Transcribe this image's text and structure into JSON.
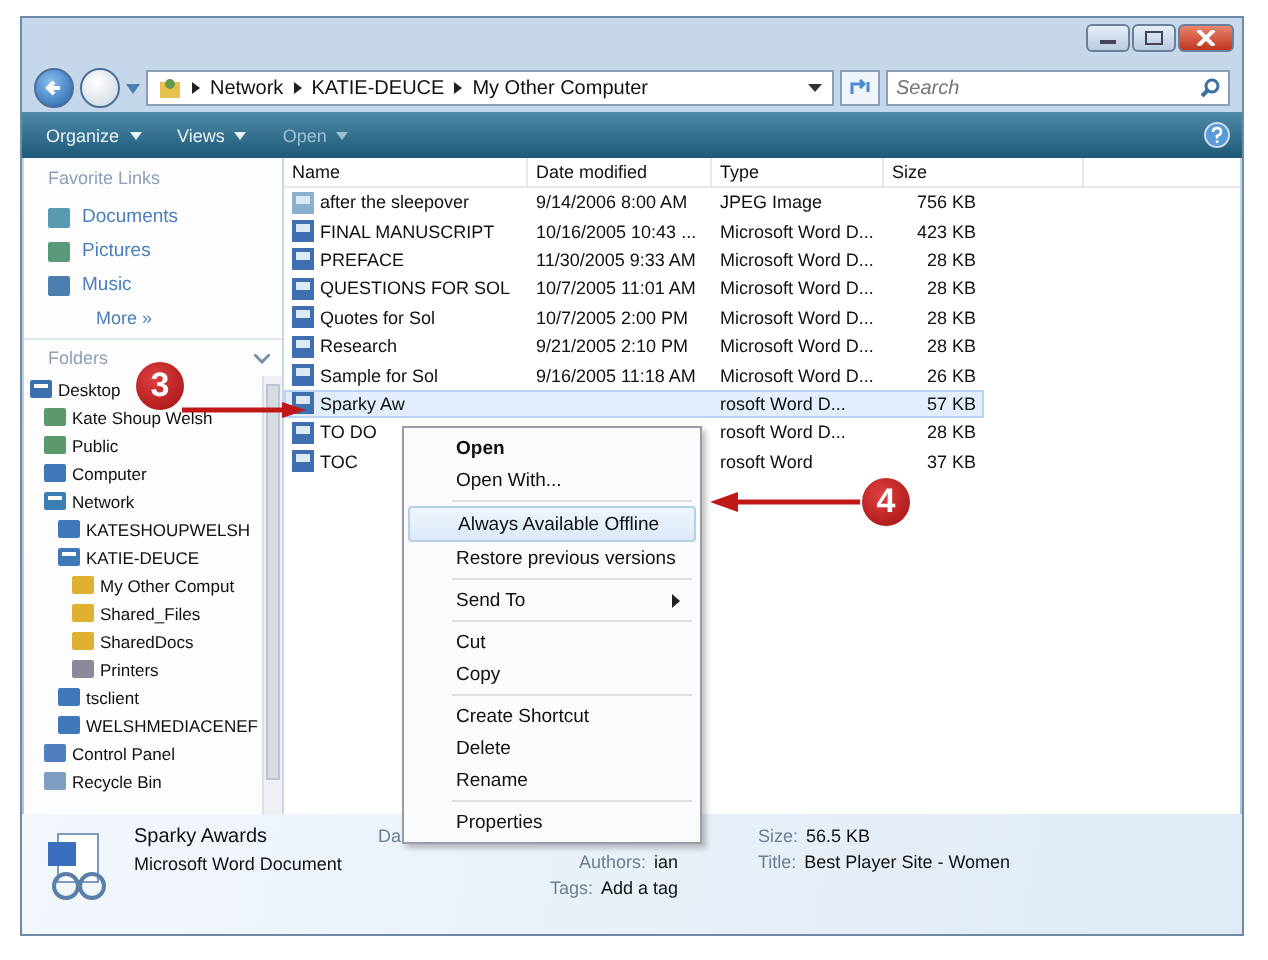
{
  "address": {
    "crumbs": [
      "Network",
      "KATIE-DEUCE",
      "My Other Computer"
    ]
  },
  "search": {
    "placeholder": "Search"
  },
  "toolbar": [
    {
      "label": "Organize",
      "disabled": false
    },
    {
      "label": "Views",
      "disabled": false
    },
    {
      "label": "Open",
      "disabled": true
    }
  ],
  "favorite_links": {
    "title": "Favorite Links",
    "items": [
      {
        "label": "Documents",
        "kind": "docs"
      },
      {
        "label": "Pictures",
        "kind": "pics"
      },
      {
        "label": "Music",
        "kind": "music"
      }
    ],
    "more": "More »"
  },
  "folders": {
    "title": "Folders",
    "tree": [
      {
        "label": "Desktop",
        "kind": "desktop",
        "expanded": true,
        "children": [
          {
            "label": "Kate Shoup Welsh",
            "kind": "user"
          },
          {
            "label": "Public",
            "kind": "user"
          },
          {
            "label": "Computer",
            "kind": "computer"
          },
          {
            "label": "Network",
            "kind": "network",
            "expanded": true,
            "children": [
              {
                "label": "KATESHOUPWELSH",
                "kind": "computer"
              },
              {
                "label": "KATIE-DEUCE",
                "kind": "computer",
                "expanded": true,
                "children": [
                  {
                    "label": "My Other Comput",
                    "kind": "share"
                  },
                  {
                    "label": "Shared_Files",
                    "kind": "share"
                  },
                  {
                    "label": "SharedDocs",
                    "kind": "share"
                  },
                  {
                    "label": "Printers",
                    "kind": "printer"
                  }
                ]
              },
              {
                "label": "tsclient",
                "kind": "computer"
              },
              {
                "label": "WELSHMEDIACENEF",
                "kind": "computer"
              }
            ]
          },
          {
            "label": "Control Panel",
            "kind": "control"
          },
          {
            "label": "Recycle Bin",
            "kind": "recycle"
          }
        ]
      }
    ]
  },
  "table": {
    "columns": [
      "Name",
      "Date modified",
      "Type",
      "Size"
    ],
    "rows": [
      {
        "name": "after the sleepover",
        "date": "9/14/2006 8:00 AM",
        "type": "JPEG Image",
        "size": "756 KB",
        "kind": "image",
        "selected": false
      },
      {
        "name": "FINAL MANUSCRIPT",
        "date": "10/16/2005 10:43 ...",
        "type": "Microsoft Word D...",
        "size": "423 KB",
        "kind": "doc",
        "selected": false
      },
      {
        "name": "PREFACE",
        "date": "11/30/2005 9:33 AM",
        "type": "Microsoft Word D...",
        "size": "28 KB",
        "kind": "doc",
        "selected": false
      },
      {
        "name": "QUESTIONS FOR SOL",
        "date": "10/7/2005 11:01 AM",
        "type": "Microsoft Word D...",
        "size": "28 KB",
        "kind": "doc",
        "selected": false
      },
      {
        "name": "Quotes for Sol",
        "date": "10/7/2005 2:00 PM",
        "type": "Microsoft Word D...",
        "size": "28 KB",
        "kind": "doc",
        "selected": false
      },
      {
        "name": "Research",
        "date": "9/21/2005 2:10 PM",
        "type": "Microsoft Word D...",
        "size": "28 KB",
        "kind": "doc",
        "selected": false
      },
      {
        "name": "Sample for Sol",
        "date": "9/16/2005 11:18 AM",
        "type": "Microsoft Word D...",
        "size": "26 KB",
        "kind": "doc",
        "selected": false
      },
      {
        "name": "Sparky Aw",
        "type": "rosoft Word D...",
        "size": "57 KB",
        "kind": "doc",
        "selected": true
      },
      {
        "name": "TO DO",
        "type": "rosoft Word D...",
        "size": "28 KB",
        "kind": "doc",
        "selected": false
      },
      {
        "name": "TOC",
        "type": "rosoft Word",
        "size": "37 KB",
        "kind": "doc",
        "selected": false
      }
    ]
  },
  "context_menu": [
    {
      "kind": "item",
      "label": "Open",
      "default": true,
      "selected": false,
      "submenu": false
    },
    {
      "kind": "item",
      "label": "Open With...",
      "default": false,
      "selected": false,
      "submenu": false
    },
    {
      "kind": "separator"
    },
    {
      "kind": "item",
      "label": "Always Available Offline",
      "default": false,
      "selected": true,
      "submenu": false
    },
    {
      "kind": "item",
      "label": "Restore previous versions",
      "default": false,
      "selected": false,
      "submenu": false
    },
    {
      "kind": "separator"
    },
    {
      "kind": "item",
      "label": "Send To",
      "default": false,
      "selected": false,
      "submenu": true
    },
    {
      "kind": "separator"
    },
    {
      "kind": "item",
      "label": "Cut",
      "default": false,
      "selected": false,
      "submenu": false
    },
    {
      "kind": "item",
      "label": "Copy",
      "default": false,
      "selected": false,
      "submenu": false
    },
    {
      "kind": "separator"
    },
    {
      "kind": "item",
      "label": "Create Shortcut",
      "default": false,
      "selected": false,
      "submenu": false
    },
    {
      "kind": "item",
      "label": "Delete",
      "default": false,
      "selected": false,
      "submenu": false
    },
    {
      "kind": "item",
      "label": "Rename",
      "default": false,
      "selected": false,
      "submenu": false
    },
    {
      "kind": "separator"
    },
    {
      "kind": "item",
      "label": "Properties",
      "default": false,
      "selected": false,
      "submenu": false
    }
  ],
  "details": {
    "name": "Sparky Awards",
    "type": "Microsoft Word Document",
    "cut_label": "Da",
    "fields": [
      {
        "label": "Authors:",
        "value": "ian"
      },
      {
        "label": "Tags:",
        "value": "Add a tag"
      }
    ],
    "side_fields": [
      {
        "label": "Size:",
        "value": "56.5 KB"
      },
      {
        "label": "Title:",
        "value": "Best Player Site - Women"
      }
    ]
  },
  "callouts": [
    {
      "number": "3"
    },
    {
      "number": "4"
    }
  ]
}
